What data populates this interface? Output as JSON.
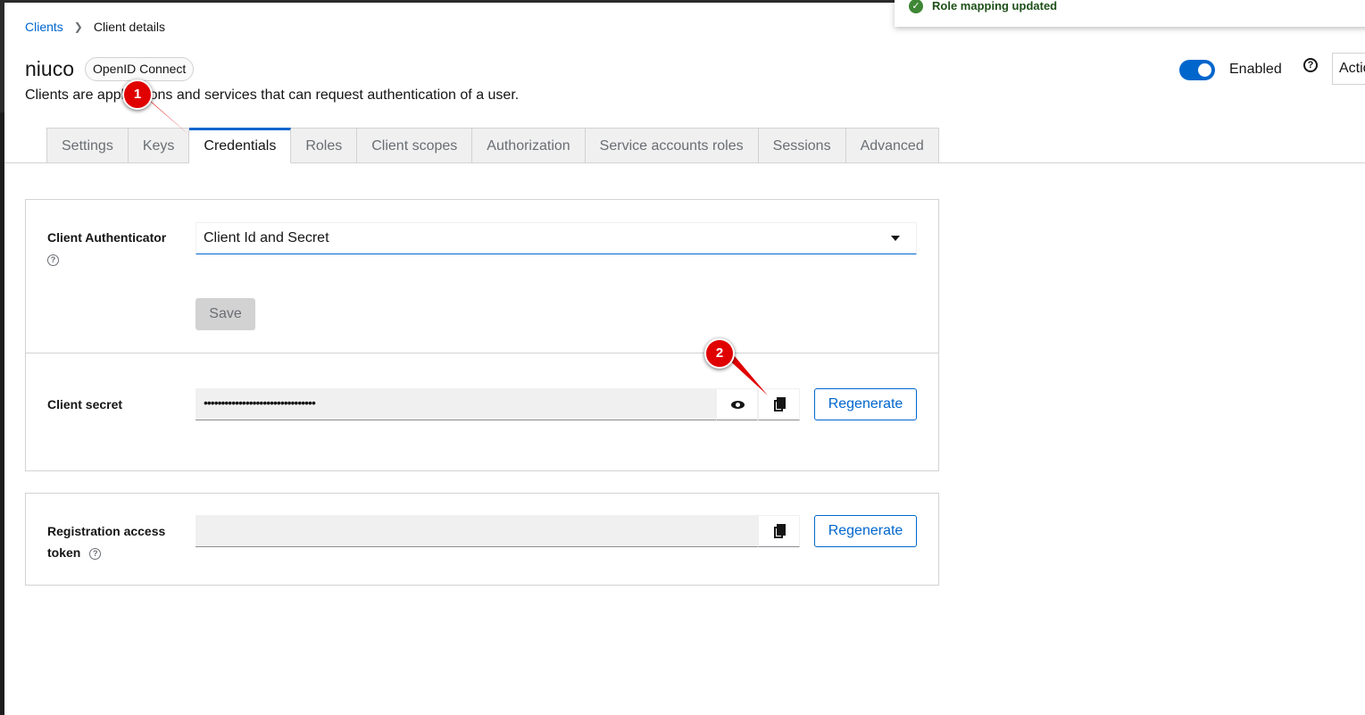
{
  "breadcrumb": {
    "root": "Clients",
    "current": "Client details"
  },
  "client": {
    "name": "niuco",
    "protocol_badge": "OpenID Connect",
    "description": "Clients are applications and services that can request authentication of a user."
  },
  "header": {
    "enabled_label": "Enabled",
    "action_label": "Action"
  },
  "toast": {
    "message": "Role mapping updated"
  },
  "tabs": [
    {
      "label": "Settings"
    },
    {
      "label": "Keys"
    },
    {
      "label": "Credentials"
    },
    {
      "label": "Roles"
    },
    {
      "label": "Client scopes"
    },
    {
      "label": "Authorization"
    },
    {
      "label": "Service accounts roles"
    },
    {
      "label": "Sessions"
    },
    {
      "label": "Advanced"
    }
  ],
  "credentials": {
    "authenticator_label": "Client Authenticator",
    "authenticator_value": "Client Id and Secret",
    "save_label": "Save",
    "secret_label": "Client secret",
    "secret_value": "••••••••••••••••••••••••••••••••",
    "regenerate_label": "Regenerate",
    "token_label_line1": "Registration access",
    "token_label_line2": "token",
    "token_regenerate_label": "Regenerate"
  },
  "annotations": {
    "marker1": "1",
    "marker2": "2"
  },
  "colors": {
    "accent": "#0066cc",
    "marker": "#e00000",
    "success": "#3e8635"
  }
}
